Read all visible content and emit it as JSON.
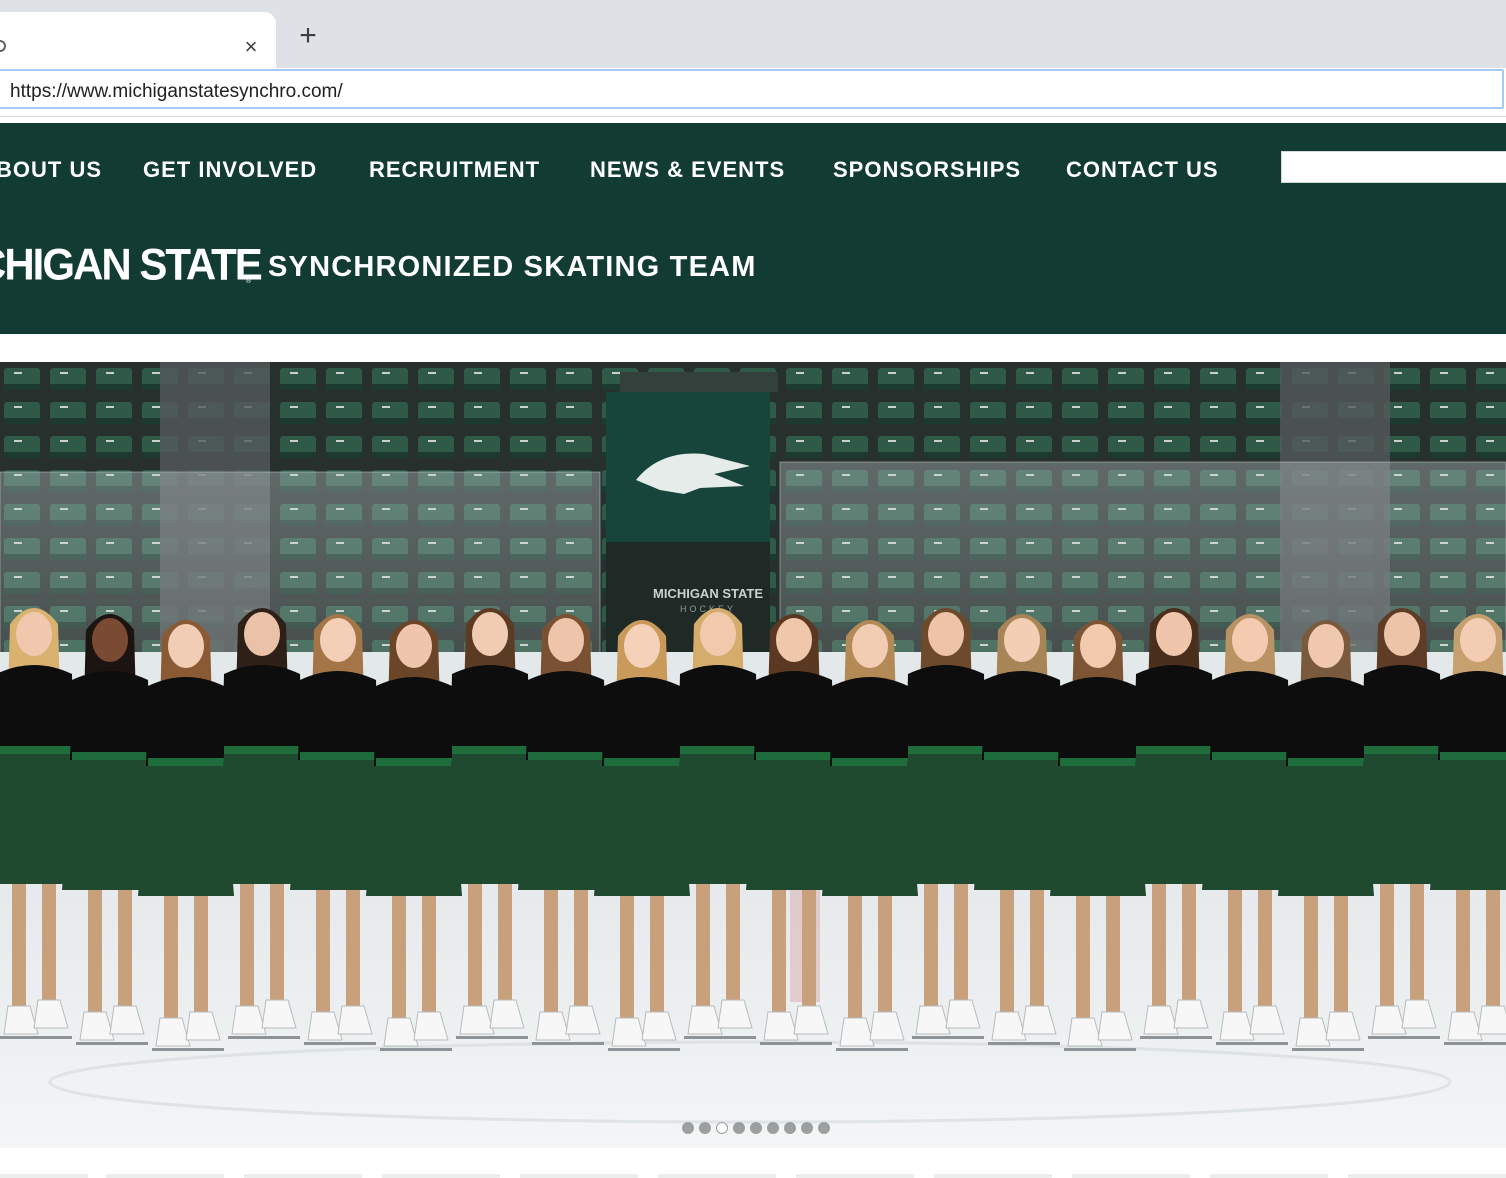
{
  "browser": {
    "url": "https://www.michiganstatesynchro.com/",
    "tab_close_glyph": "×",
    "new_tab_glyph": "+"
  },
  "nav": {
    "items": [
      {
        "label": "BOUT US"
      },
      {
        "label": "GET INVOLVED"
      },
      {
        "label": "RECRUITMENT"
      },
      {
        "label": "NEWS & EVENTS"
      },
      {
        "label": "SPONSORSHIPS"
      },
      {
        "label": "CONTACT US"
      }
    ],
    "search_placeholder": ""
  },
  "brand": {
    "wordmark": "CHIGAN STATE",
    "registered": "®",
    "tagline": "SYNCHRONIZED SKATING TEAM"
  },
  "hero": {
    "alt": "Team photo of skaters in black tops and green skirts lined up on the ice",
    "sign_text": "MICHIGAN STATE",
    "sign_subtext": "HOCKEY"
  },
  "slider": {
    "dot_count": 9,
    "active_index": 2
  },
  "colors": {
    "brand_green": "#123c33",
    "skirt_green": "#1f4a30",
    "ice": "#e9eeef"
  }
}
